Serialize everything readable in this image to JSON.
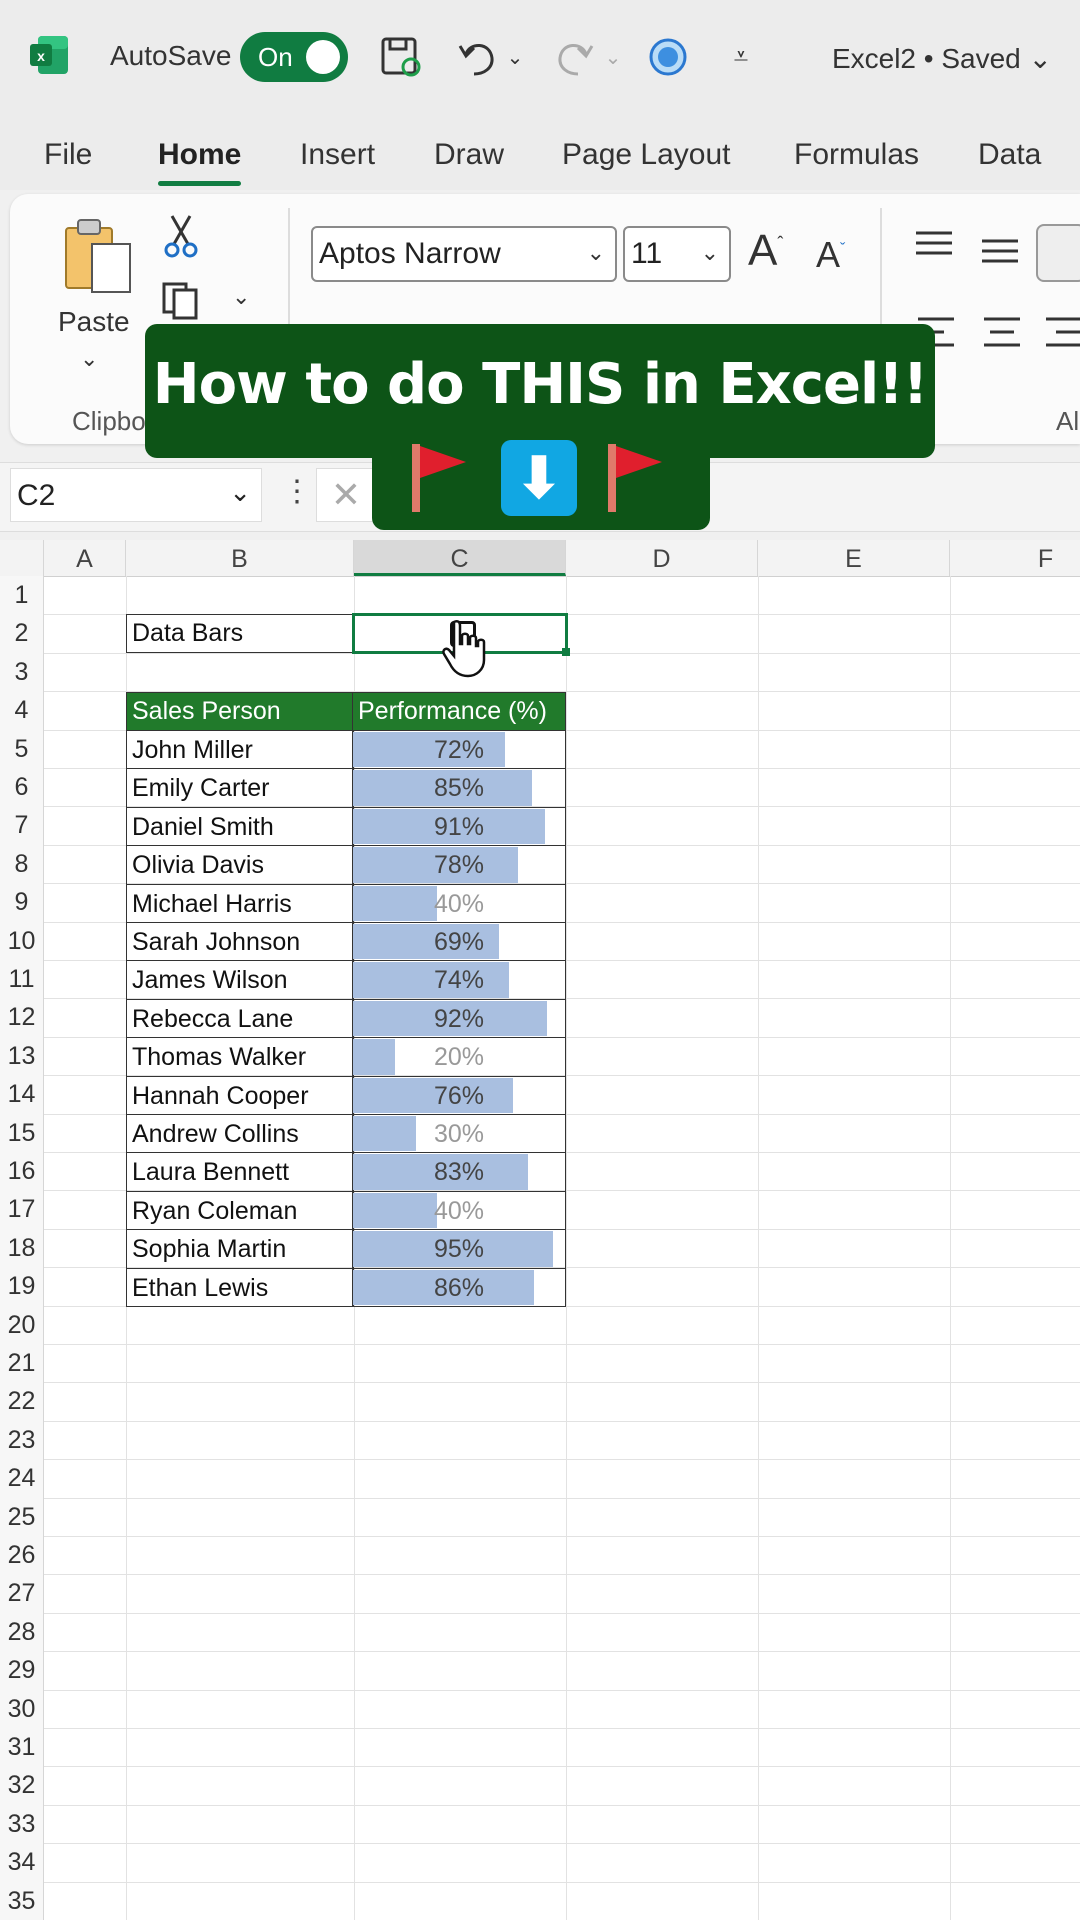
{
  "titlebar": {
    "autosave_label": "AutoSave",
    "toggle_state": "On",
    "doc_title": "Excel2 • Saved"
  },
  "menu": {
    "tabs": [
      "File",
      "Home",
      "Insert",
      "Draw",
      "Page Layout",
      "Formulas",
      "Data"
    ],
    "active": "Home"
  },
  "ribbon": {
    "paste_label": "Paste",
    "clipboard_group": "Clipboard",
    "font_name": "Aptos Narrow",
    "font_size": "11",
    "alignment_group": "Alignment"
  },
  "formula_bar": {
    "name_box": "C2"
  },
  "banner": {
    "title": "How to do THIS in Excel!!"
  },
  "sheet": {
    "columns": [
      "A",
      "B",
      "C",
      "D",
      "E",
      "F"
    ],
    "active_column": "C",
    "row_numbers": [
      "1",
      "2",
      "3",
      "4",
      "5",
      "6",
      "7",
      "8",
      "9",
      "10",
      "11",
      "12",
      "13",
      "14",
      "15",
      "16",
      "17",
      "18",
      "19",
      "20",
      "21",
      "22",
      "23",
      "24",
      "25",
      "26",
      "27",
      "28",
      "29",
      "30",
      "31",
      "32",
      "33",
      "34",
      "35"
    ],
    "label_cell": "Data Bars",
    "table_headers": [
      "Sales Person",
      "Performance (%)"
    ],
    "rows": [
      {
        "name": "John Miller",
        "pct": "72%",
        "value": 72
      },
      {
        "name": "Emily Carter",
        "pct": "85%",
        "value": 85
      },
      {
        "name": "Daniel Smith",
        "pct": "91%",
        "value": 91
      },
      {
        "name": "Olivia Davis",
        "pct": "78%",
        "value": 78
      },
      {
        "name": "Michael Harris",
        "pct": "40%",
        "value": 40
      },
      {
        "name": "Sarah Johnson",
        "pct": "69%",
        "value": 69
      },
      {
        "name": "James Wilson",
        "pct": "74%",
        "value": 74
      },
      {
        "name": "Rebecca Lane",
        "pct": "92%",
        "value": 92
      },
      {
        "name": "Thomas Walker",
        "pct": "20%",
        "value": 20
      },
      {
        "name": "Hannah Cooper",
        "pct": "76%",
        "value": 76
      },
      {
        "name": "Andrew Collins",
        "pct": "30%",
        "value": 30
      },
      {
        "name": "Laura Bennett",
        "pct": "83%",
        "value": 83
      },
      {
        "name": "Ryan Coleman",
        "pct": "40%",
        "value": 40
      },
      {
        "name": "Sophia Martin",
        "pct": "95%",
        "value": 95
      },
      {
        "name": "Ethan Lewis",
        "pct": "86%",
        "value": 86
      }
    ]
  },
  "colors": {
    "excel_green": "#107c41",
    "table_header": "#217a2b",
    "data_bar": "#a9bfe0",
    "banner": "#0d5417"
  }
}
